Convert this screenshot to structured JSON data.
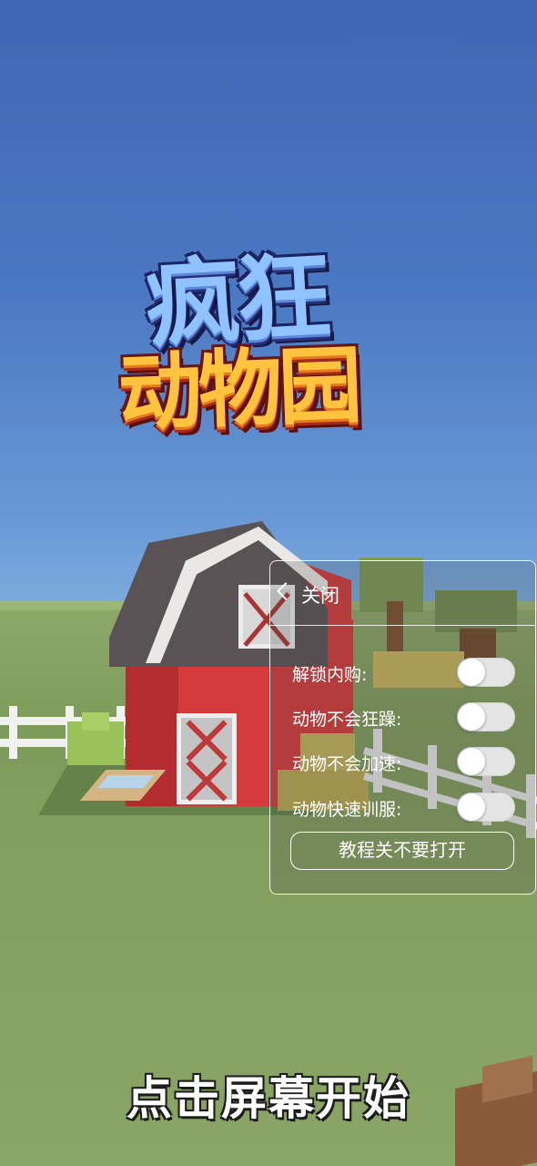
{
  "title": {
    "line1": "疯狂",
    "line2": "动物园"
  },
  "cheat_panel": {
    "close_label": "关闭",
    "options": [
      {
        "label": "解锁内购:",
        "enabled": false
      },
      {
        "label": "动物不会狂躁:",
        "enabled": false
      },
      {
        "label": "动物不会加速:",
        "enabled": false
      },
      {
        "label": "动物快速训服:",
        "enabled": false
      }
    ],
    "tutorial_button": "教程关不要打开"
  },
  "start_prompt": "点击屏幕开始"
}
